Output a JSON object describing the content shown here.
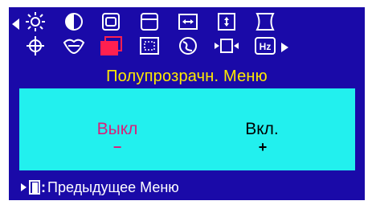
{
  "osd": {
    "menu_title": "Полупрозрачн. Меню",
    "icons_row1": [
      "nav-left-arrow",
      "brightness-icon",
      "contrast-icon",
      "position-icon",
      "size-icon",
      "h-position-icon",
      "v-position-icon",
      "pincushion-icon"
    ],
    "icons_row2": [
      "rotation-icon",
      "trapezoid-icon",
      "transparency-icon",
      "zoom-icon",
      "degauss-icon",
      "input-icon",
      "frequency-icon",
      "nav-right-arrow"
    ],
    "selected_icon": "transparency-icon",
    "hz_label": "Hz",
    "options": {
      "off_label": "Выкл",
      "off_symbol": "−",
      "on_label": "Вкл.",
      "on_symbol": "+",
      "selected": "off"
    },
    "footer": {
      "separator": ":",
      "text": "Предыдущее Меню"
    },
    "colors": {
      "background": "#1a0aa8",
      "title": "#ffea00",
      "panel": "#22f0ee",
      "selected_option": "#d8207a",
      "selected_icon": "#ff2050",
      "icons": "#ffffff",
      "option_text": "#000000"
    }
  }
}
